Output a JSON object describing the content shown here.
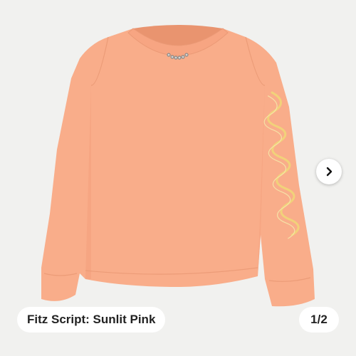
{
  "gallery": {
    "caption": "Fitz Script: Sunlit Pink",
    "counter": "1/2",
    "next_icon": "chevron-right-icon",
    "image": {
      "description_icon": "long-sleeve-shirt",
      "shirt_color": "#f9ad8a",
      "script_color": "#f1d27a",
      "background_color": "#f1f1ef"
    }
  }
}
